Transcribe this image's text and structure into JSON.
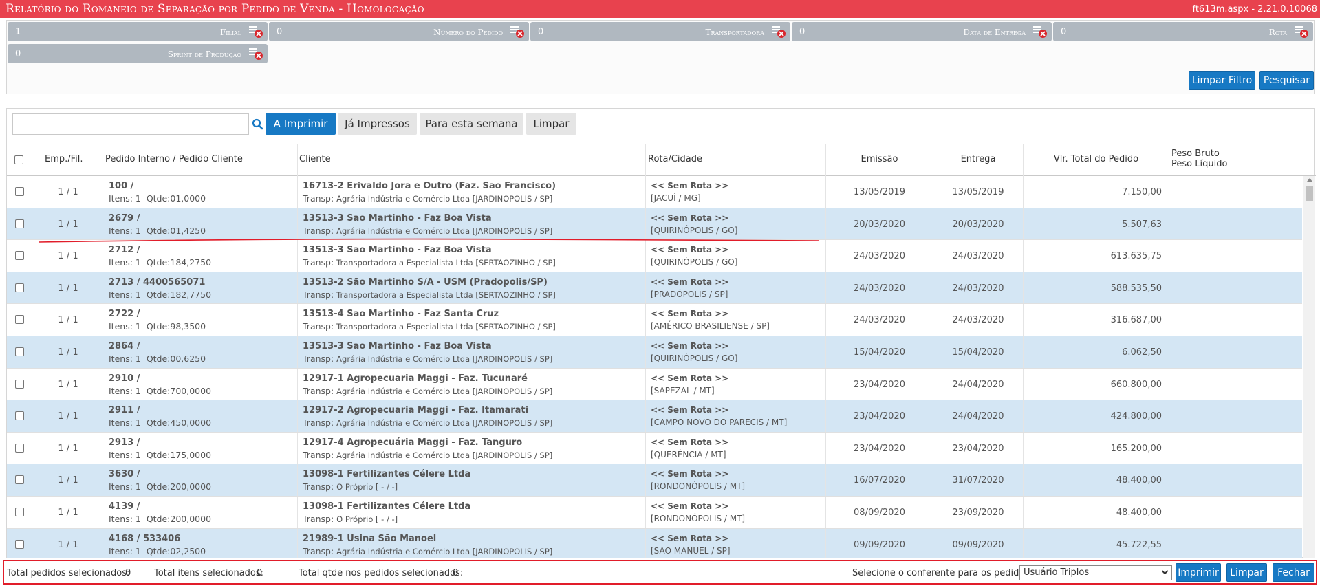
{
  "header": {
    "title": "Relatório do Romaneio de Separação por Pedido de Venda  - Homologação",
    "version": "ft613m.aspx - 2.21.0.10068"
  },
  "filters": [
    {
      "value": "1",
      "label": "Filial"
    },
    {
      "value": "0",
      "label": "Número do Pedido"
    },
    {
      "value": "0",
      "label": "Transportadora"
    },
    {
      "value": "0",
      "label": "Data de Entrega"
    },
    {
      "value": "0",
      "label": "Rota"
    },
    {
      "value": "0",
      "label": "Sprint de Produção"
    }
  ],
  "filter_actions": {
    "clear": "Limpar Filtro",
    "search": "Pesquisar"
  },
  "search": {
    "value": "",
    "placeholder": ""
  },
  "tabs": [
    {
      "label": "A Imprimir",
      "active": true
    },
    {
      "label": "Já Impressos",
      "active": false
    },
    {
      "label": "Para esta semana",
      "active": false
    },
    {
      "label": "Limpar",
      "active": false
    }
  ],
  "columns": {
    "emp": "Emp./Fil.",
    "pedido": "Pedido Interno / Pedido Cliente",
    "cliente": "Cliente",
    "rota": "Rota/Cidade",
    "emissao": "Emissão",
    "entrega": "Entrega",
    "valor": "Vlr. Total do Pedido",
    "peso_bruto": "Peso Bruto",
    "peso_liquido": "Peso Líquido"
  },
  "rows": [
    {
      "emp": "1 / 1",
      "pedido": "100 /",
      "itens": "Itens: 1",
      "qtde": "Qtde:01,0000",
      "cliente": "16713-2 Erivaldo Jora e Outro (Faz. Sao Francisco)",
      "transp_label": "Transp:",
      "transp": "Agrária Indústria e Comércio Ltda [JARDINOPOLIS / SP]",
      "rota": "<< Sem Rota >>",
      "cidade": "[JACUÍ / MG]",
      "emissao": "13/05/2019",
      "entrega": "13/05/2019",
      "valor": "7.150,00"
    },
    {
      "emp": "1 / 1",
      "pedido": "2679 /",
      "itens": "Itens: 1",
      "qtde": "Qtde:01,4250",
      "cliente": "13513-3 Sao Martinho - Faz Boa Vista",
      "transp_label": "Transp:",
      "transp": "Agrária Indústria e Comércio Ltda [JARDINOPOLIS / SP]",
      "rota": "<< Sem Rota >>",
      "cidade": "[QUIRINÓPOLIS / GO]",
      "emissao": "20/03/2020",
      "entrega": "20/03/2020",
      "valor": "5.507,63"
    },
    {
      "emp": "1 / 1",
      "pedido": "2712 /",
      "itens": "Itens: 1",
      "qtde": "Qtde:184,2750",
      "cliente": "13513-3 Sao Martinho - Faz Boa Vista",
      "transp_label": "Transp:",
      "transp": "Transportadora a Especialista Ltda [SERTAOZINHO / SP]",
      "rota": "<< Sem Rota >>",
      "cidade": "[QUIRINÓPOLIS / GO]",
      "emissao": "24/03/2020",
      "entrega": "24/03/2020",
      "valor": "613.635,75"
    },
    {
      "emp": "1 / 1",
      "pedido": "2713 / 4400565071",
      "itens": "Itens: 1",
      "qtde": "Qtde:182,7750",
      "cliente": "13513-2 São Martinho S/A - USM (Pradopolis/SP)",
      "transp_label": "Transp:",
      "transp": "Transportadora a Especialista Ltda [SERTAOZINHO / SP]",
      "rota": "<< Sem Rota >>",
      "cidade": "[PRADÓPOLIS / SP]",
      "emissao": "24/03/2020",
      "entrega": "24/03/2020",
      "valor": "588.535,50"
    },
    {
      "emp": "1 / 1",
      "pedido": "2722 /",
      "itens": "Itens: 1",
      "qtde": "Qtde:98,3500",
      "cliente": "13513-4 Sao Martinho - Faz Santa Cruz",
      "transp_label": "Transp:",
      "transp": "Transportadora a Especialista Ltda [SERTAOZINHO / SP]",
      "rota": "<< Sem Rota >>",
      "cidade": "[AMÉRICO BRASILIENSE / SP]",
      "emissao": "24/03/2020",
      "entrega": "24/03/2020",
      "valor": "316.687,00"
    },
    {
      "emp": "1 / 1",
      "pedido": "2864 /",
      "itens": "Itens: 1",
      "qtde": "Qtde:00,6250",
      "cliente": "13513-3 Sao Martinho - Faz Boa Vista",
      "transp_label": "Transp:",
      "transp": "Agrária Indústria e Comércio Ltda [JARDINOPOLIS / SP]",
      "rota": "<< Sem Rota >>",
      "cidade": "[QUIRINÓPOLIS / GO]",
      "emissao": "15/04/2020",
      "entrega": "15/04/2020",
      "valor": "6.062,50"
    },
    {
      "emp": "1 / 1",
      "pedido": "2910 /",
      "itens": "Itens: 1",
      "qtde": "Qtde:700,0000",
      "cliente": "12917-1 Agropecuaria Maggi - Faz. Tucunaré",
      "transp_label": "Transp:",
      "transp": "Agrária Indústria e Comércio Ltda [JARDINOPOLIS / SP]",
      "rota": "<< Sem Rota >>",
      "cidade": "[SAPEZAL / MT]",
      "emissao": "23/04/2020",
      "entrega": "24/04/2020",
      "valor": "660.800,00"
    },
    {
      "emp": "1 / 1",
      "pedido": "2911 /",
      "itens": "Itens: 1",
      "qtde": "Qtde:450,0000",
      "cliente": "12917-2 Agropecuaria Maggi - Faz. Itamarati",
      "transp_label": "Transp:",
      "transp": "Agrária Indústria e Comércio Ltda [JARDINOPOLIS / SP]",
      "rota": "<< Sem Rota >>",
      "cidade": "[CAMPO NOVO DO PARECIS / MT]",
      "emissao": "23/04/2020",
      "entrega": "24/04/2020",
      "valor": "424.800,00"
    },
    {
      "emp": "1 / 1",
      "pedido": "2913 /",
      "itens": "Itens: 1",
      "qtde": "Qtde:175,0000",
      "cliente": "12917-4 Agropecuária Maggi - Faz. Tanguro",
      "transp_label": "Transp:",
      "transp": "Agrária Indústria e Comércio Ltda [JARDINOPOLIS / SP]",
      "rota": "<< Sem Rota >>",
      "cidade": "[QUERÊNCIA / MT]",
      "emissao": "23/04/2020",
      "entrega": "23/04/2020",
      "valor": "165.200,00"
    },
    {
      "emp": "1 / 1",
      "pedido": "3630 /",
      "itens": "Itens: 1",
      "qtde": "Qtde:200,0000",
      "cliente": "13098-1 Fertilizantes Célere Ltda",
      "transp_label": "Transp:",
      "transp": "O Próprio [ - / -]",
      "rota": "<< Sem Rota >>",
      "cidade": "[RONDONÓPOLIS / MT]",
      "emissao": "16/07/2020",
      "entrega": "31/07/2020",
      "valor": "48.400,00"
    },
    {
      "emp": "1 / 1",
      "pedido": "4139 /",
      "itens": "Itens: 1",
      "qtde": "Qtde:200,0000",
      "cliente": "13098-1 Fertilizantes Célere Ltda",
      "transp_label": "Transp:",
      "transp": "O Próprio [ - / -]",
      "rota": "<< Sem Rota >>",
      "cidade": "[RONDONÓPOLIS / MT]",
      "emissao": "08/09/2020",
      "entrega": "23/09/2020",
      "valor": "48.400,00"
    },
    {
      "emp": "1 / 1",
      "pedido": "4168 / 533406",
      "itens": "Itens: 1",
      "qtde": "Qtde:02,2500",
      "cliente": "21989-1 Usina São Manoel",
      "transp_label": "Transp:",
      "transp": "Agrária Indústria e Comércio Ltda [JARDINOPOLIS / SP]",
      "rota": "<< Sem Rota >>",
      "cidade": "[SAO MANUEL / SP]",
      "emissao": "09/09/2020",
      "entrega": "09/09/2020",
      "valor": "45.722,55"
    }
  ],
  "footer": {
    "total_pedidos": "Total pedidos selecionados:",
    "total_pedidos_value": "0",
    "total_itens": "Total itens selecionados:",
    "total_itens_value": "0",
    "total_qtde": "Total qtde nos pedidos selecionados:",
    "total_qtde_value": "0",
    "conferente_label": "Selecione o conferente para os pedidos:",
    "conferente_value": "Usuário Triplos",
    "print": "Imprimir",
    "clear": "Limpar",
    "close": "Fechar"
  },
  "colors": {
    "header_red": "#e8424e",
    "chip_gray": "#b0b8c0",
    "primary_blue": "#1779c4",
    "row_alt": "#d4e6f4",
    "highlight_red": "#e11d2a"
  },
  "icons": {
    "chip_clear": "filter-clear-icon",
    "search": "search-icon"
  }
}
